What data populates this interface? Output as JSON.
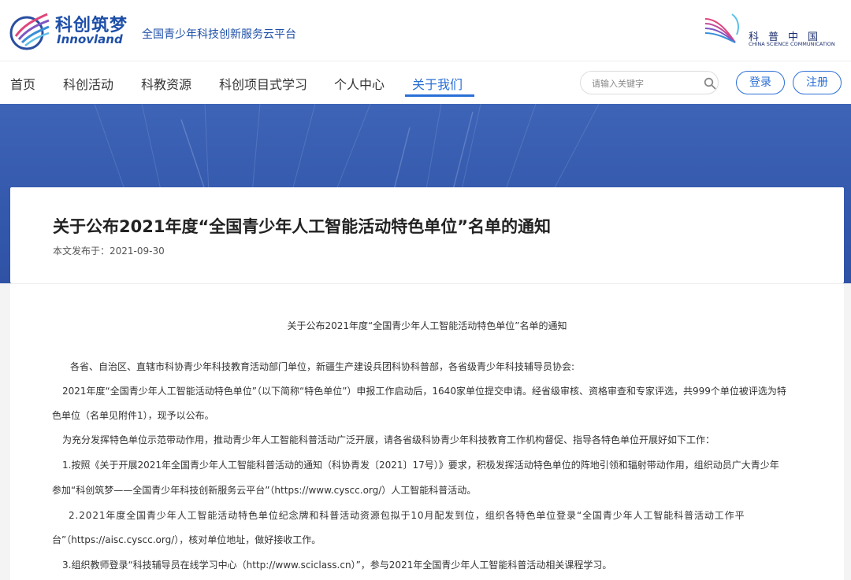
{
  "header": {
    "brand_cn": "科创筑梦",
    "brand_en": "Innovland",
    "platform": "全国青少年科技创新服务云平台",
    "partner_cn": "科普中国",
    "partner_en": "CHINA SCIENCE COMMUNICATION"
  },
  "nav": {
    "items": [
      {
        "label": "首页"
      },
      {
        "label": "科创活动"
      },
      {
        "label": "科教资源"
      },
      {
        "label": "科创项目式学习"
      },
      {
        "label": "个人中心"
      },
      {
        "label": "关于我们"
      }
    ],
    "active_index": 5,
    "search_placeholder": "请输入关键字",
    "login_label": "登录",
    "register_label": "注册"
  },
  "colors": {
    "brand_blue": "#1e4fa8",
    "accent_blue": "#2a6fd6",
    "banner_blue": "#3459ad"
  },
  "article": {
    "title": "关于公布2021年度“全国青少年人工智能活动特色单位”名单的通知",
    "date_line": "本文发布于：2021-09-30",
    "doc_title": "关于公布2021年度“全国青少年人工智能活动特色单位”名单的通知",
    "lines": [
      "各省、自治区、直辖市科协青少年科技教育活动部门单位，新疆生产建设兵团科协科普部，各省级青少年科技辅导员协会:",
      "2021年度“全国青少年人工智能活动特色单位”（以下简称“特色单位”）申报工作启动后，1640家单位提交申请。经省级审核、资格审查和专家评选，共999个单位被评选为特",
      "色单位（名单见附件1），现予以公布。",
      "为充分发挥特色单位示范带动作用，推动青少年人工智能科普活动广泛开展，请各省级科协青少年科技教育工作机构督促、指导各特色单位开展好如下工作：",
      "1.按照《关于开展2021年全国青少年人工智能科普活动的通知（科协青发〔2021〕17号）》要求，积极发挥活动特色单位的阵地引领和辐射带动作用，组织动员广大青少年",
      "参加“科创筑梦——全国青少年科技创新服务云平台”（https://www.cyscc.org/）人工智能科普活动。",
      "2.2021年度全国青少年人工智能活动特色单位纪念牌和科普活动资源包拟于10月配发到位，组织各特色单位登录“全国青少年人工智能科普活动工作平",
      "台”（https://aisc.cyscc.org/），核对单位地址，做好接收工作。",
      "3.组织教师登录“科技辅导员在线学习中心（http://www.sciclass.cn）”，参与2021年全国青少年人工智能科普活动相关课程学习。"
    ]
  }
}
